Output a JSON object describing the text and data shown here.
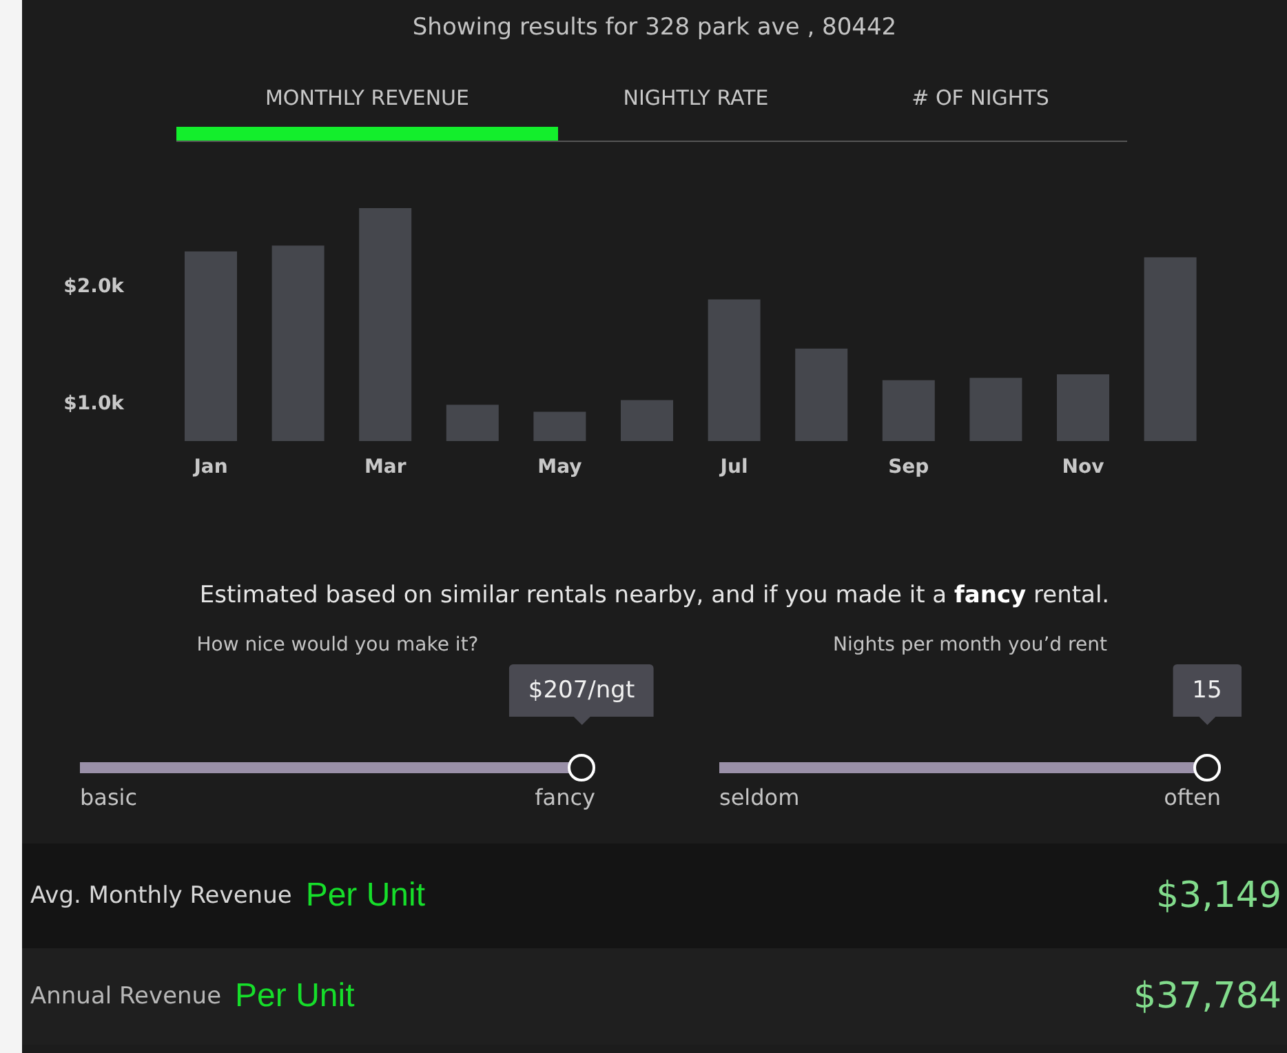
{
  "header": {
    "title": "Showing results for 328 park ave , 80442"
  },
  "tabs": [
    {
      "label": "MONTHLY REVENUE",
      "selected": true
    },
    {
      "label": "NIGHTLY RATE",
      "selected": false
    },
    {
      "label": "# OF NIGHTS",
      "selected": false
    }
  ],
  "chart": {
    "chart_data": {
      "type": "bar",
      "categories": [
        "Jan",
        null,
        "Mar",
        null,
        "May",
        null,
        "Jul",
        null,
        "Sep",
        null,
        "Nov",
        null
      ],
      "values": [
        2290,
        2340,
        2660,
        980,
        920,
        1020,
        1880,
        1460,
        1190,
        1210,
        1240,
        2240
      ],
      "ylim": [
        670,
        2660
      ],
      "yticks": [
        {
          "value": 1000,
          "label": "$1.0k"
        },
        {
          "value": 2000,
          "label": "$2.0k"
        }
      ],
      "color": "#45474d"
    }
  },
  "note": "Estimated based on similar rentals nearby, and if you made it a **fancy** rental.",
  "sliders": [
    {
      "label": "How nice would you make it?",
      "tooltip": "$207/ngt",
      "level": 1,
      "min_label": "basic",
      "max_label": "fancy"
    },
    {
      "label": "Nights per month you’d rent",
      "tooltip": "15",
      "level": 1,
      "min_label": "seldom",
      "max_label": "often"
    }
  ],
  "summary": [
    {
      "label": "Avg. Monthly Revenue",
      "tag": "Per Unit",
      "value": "$3,149"
    },
    {
      "label": "Annual Revenue",
      "tag": "Per Unit",
      "value": "$37,784"
    }
  ]
}
